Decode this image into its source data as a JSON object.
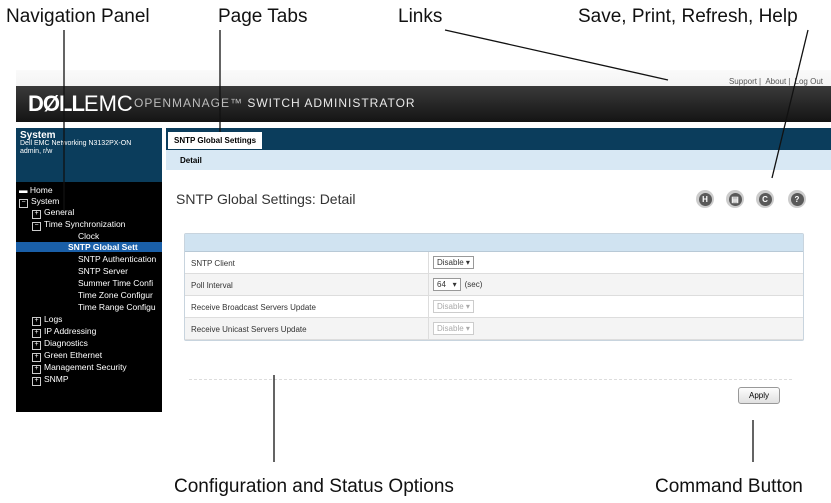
{
  "callouts": {
    "navigation_panel": "Navigation Panel",
    "page_tabs": "Page Tabs",
    "links": "Links",
    "save_print": "Save, Print, Refresh, Help",
    "config_status": "Configuration and Status Options",
    "command_button": "Command Button"
  },
  "banner": {
    "logo_bold": "DØLL",
    "logo_thin": "EMC",
    "title_prefix": "OPENMANAGE™",
    "title_rest": " SWITCH ADMINISTRATOR",
    "links": [
      "Support",
      "About",
      "Log Out"
    ]
  },
  "system": {
    "title": "System",
    "device": "Dell EMC Networking N3132PX-ON",
    "user": "admin, r/w"
  },
  "nav": {
    "items": [
      {
        "label": "Home",
        "marker": "▬"
      },
      {
        "label": "System",
        "marker": "−"
      },
      {
        "label": "General",
        "marker": "+"
      },
      {
        "label": "Time Synchronization",
        "marker": "−"
      },
      {
        "label": "Clock"
      },
      {
        "label": "SNTP Global Sett"
      },
      {
        "label": "SNTP Authentication"
      },
      {
        "label": "SNTP Server"
      },
      {
        "label": "Summer Time Confi"
      },
      {
        "label": "Time Zone Configur"
      },
      {
        "label": "Time Range Configu"
      },
      {
        "label": "Logs",
        "marker": "+"
      },
      {
        "label": "IP Addressing",
        "marker": "+"
      },
      {
        "label": "Diagnostics",
        "marker": "+"
      },
      {
        "label": "Green Ethernet",
        "marker": "+"
      },
      {
        "label": "Management Security",
        "marker": "+"
      },
      {
        "label": "SNMP",
        "marker": "+"
      }
    ]
  },
  "tabs": {
    "page_tab": "SNTP Global Settings",
    "sub_tab": "Detail"
  },
  "main": {
    "title": "SNTP Global Settings: Detail",
    "icons": [
      "H",
      "▤",
      "C",
      "?"
    ],
    "rows": [
      {
        "label": "SNTP Client",
        "value": "Disable ▾"
      },
      {
        "label": "Poll Interval",
        "value": "64   ▾",
        "unit": "(sec)"
      },
      {
        "label": "Receive Broadcast Servers Update",
        "value": "Disable ▾"
      },
      {
        "label": "Receive Unicast Servers Update",
        "value": "Disable ▾"
      }
    ],
    "apply": "Apply"
  }
}
